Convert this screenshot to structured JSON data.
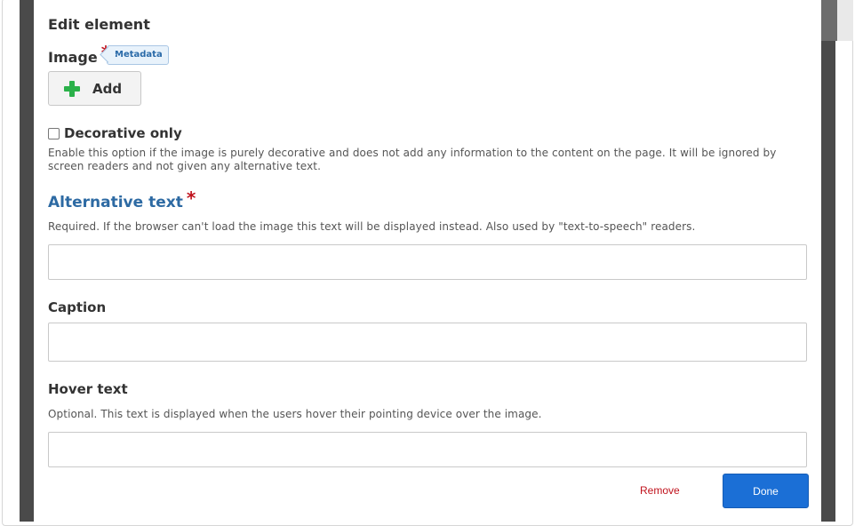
{
  "dialog": {
    "title": "Edit element"
  },
  "image_field": {
    "label": "Image",
    "required_mark": "*",
    "tag": "Metadata",
    "add_button": "Add"
  },
  "decorative": {
    "label": "Decorative only",
    "checked": false,
    "help": "Enable this option if the image is purely decorative and does not add any information to the content on the page. It will be ignored by screen readers and not given any alternative text."
  },
  "alt_text": {
    "label": "Alternative text",
    "required_mark": "*",
    "help": "Required. If the browser can't load the image this text will be displayed instead. Also used by \"text-to-speech\" readers.",
    "value": ""
  },
  "caption": {
    "label": "Caption",
    "value": ""
  },
  "hover_text": {
    "label": "Hover text",
    "help": "Optional. This text is displayed when the users hover their pointing device over the image.",
    "value": ""
  },
  "actions": {
    "remove": "Remove",
    "done": "Done"
  },
  "colors": {
    "overlay": "#4a4a4a",
    "accent_blue": "#1b6fd6",
    "label_blue": "#2d6aa3",
    "required_red": "#c0121c",
    "add_icon_green": "#2bb14a"
  },
  "icons": {
    "add": "plus-icon"
  }
}
